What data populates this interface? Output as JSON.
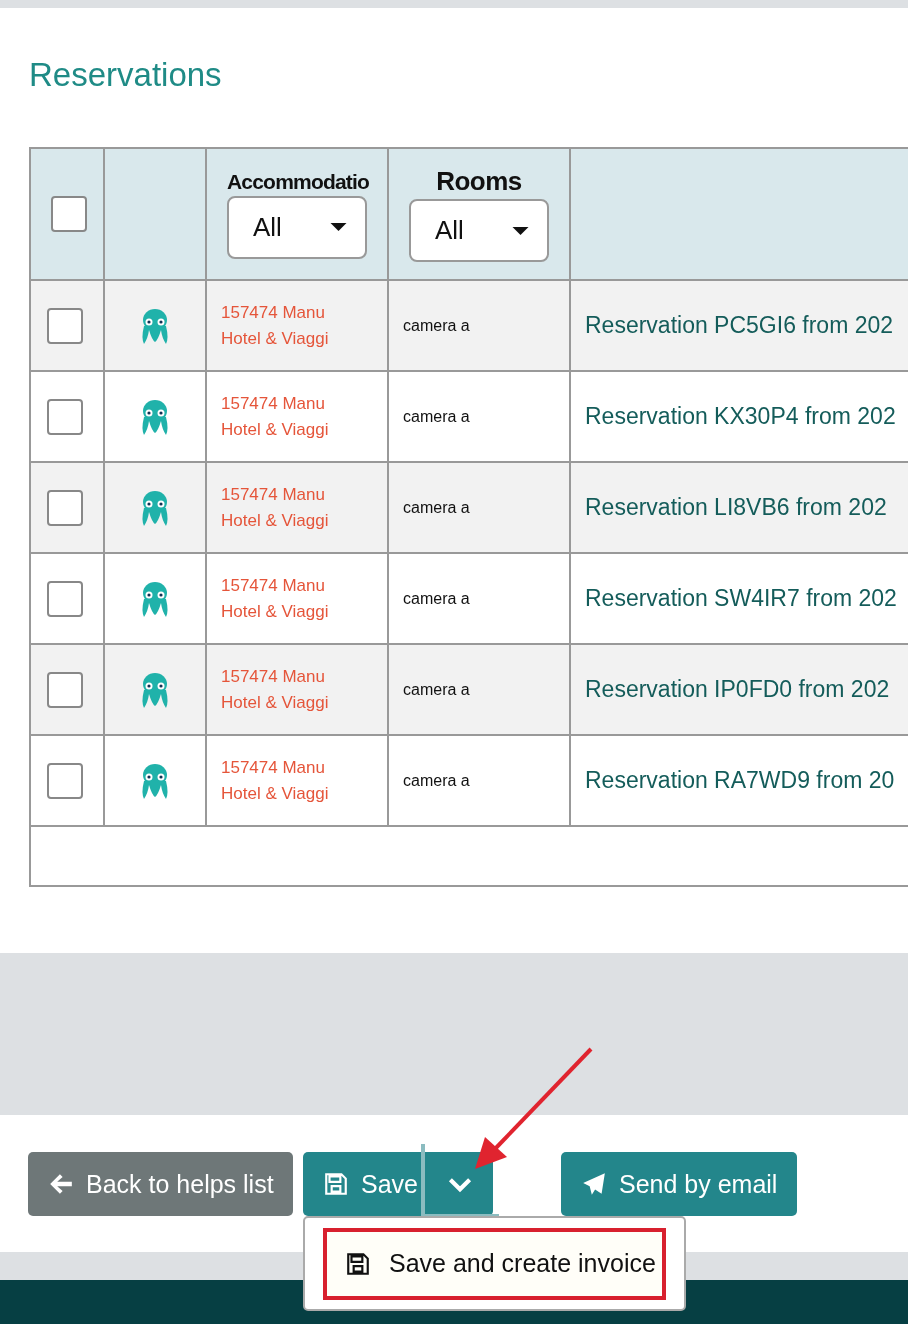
{
  "title": "Reservations",
  "table": {
    "select_all": {
      "checked": false
    },
    "columns": [
      {
        "label": "Accommodatio",
        "filter": "All"
      },
      {
        "label": "Rooms",
        "filter": "All"
      }
    ],
    "rows": [
      {
        "checked": false,
        "accommodation": "157474 Manu Hotel & Viaggi",
        "room": "camera a",
        "reservation": "Reservation PC5GI6 from 202"
      },
      {
        "checked": false,
        "accommodation": "157474 Manu Hotel & Viaggi",
        "room": "camera a",
        "reservation": "Reservation KX30P4 from 202"
      },
      {
        "checked": false,
        "accommodation": "157474 Manu Hotel & Viaggi",
        "room": "camera a",
        "reservation": "Reservation LI8VB6 from 202"
      },
      {
        "checked": false,
        "accommodation": "157474 Manu Hotel & Viaggi",
        "room": "camera a",
        "reservation": "Reservation SW4IR7 from 202"
      },
      {
        "checked": false,
        "accommodation": "157474 Manu Hotel & Viaggi",
        "room": "camera a",
        "reservation": "Reservation IP0FD0 from 202"
      },
      {
        "checked": false,
        "accommodation": "157474 Manu Hotel & Viaggi",
        "room": "camera a",
        "reservation": "Reservation RA7WD9 from 20"
      }
    ]
  },
  "buttons": {
    "back": "Back to helps list",
    "save": "Save",
    "email": "Send by email"
  },
  "save_menu": {
    "expanded": true,
    "items": [
      "Save and create invoice"
    ]
  }
}
